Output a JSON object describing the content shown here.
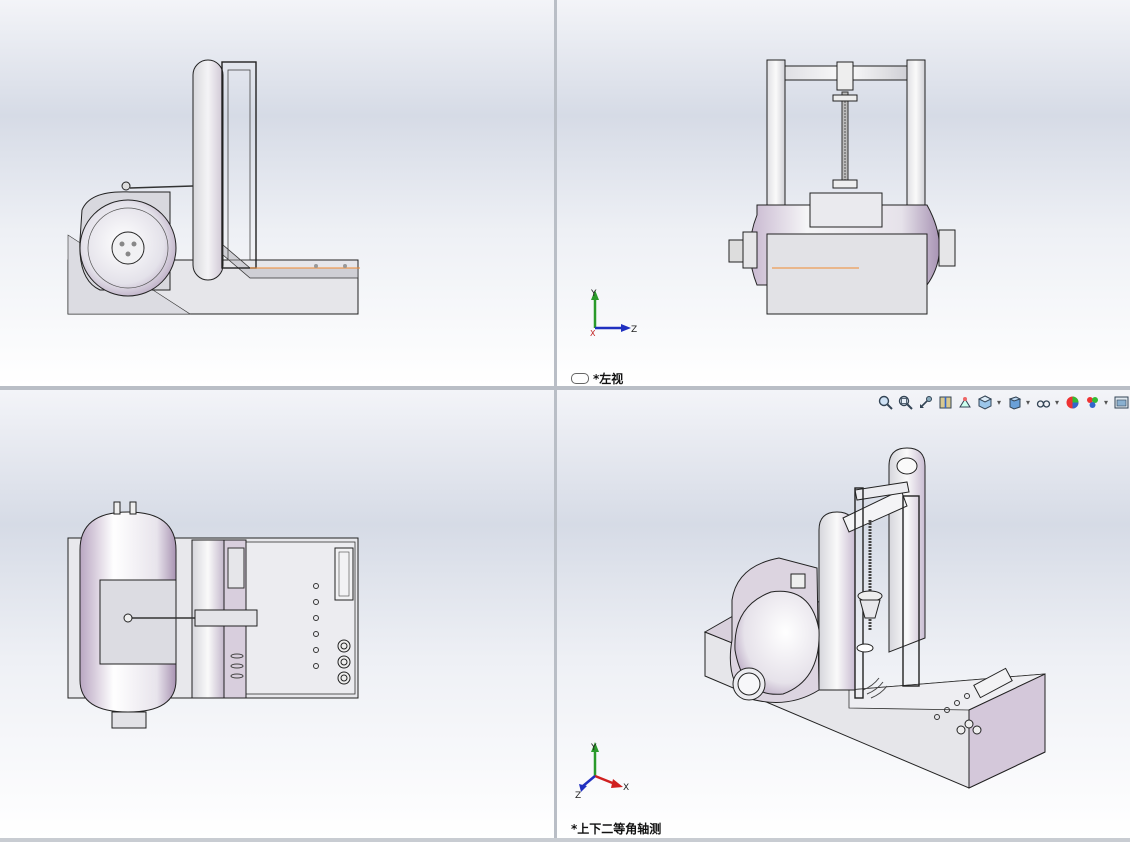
{
  "views": {
    "top_left": {
      "label": ""
    },
    "top_right": {
      "label": "*左视"
    },
    "bottom_left": {
      "label": ""
    },
    "bottom_right": {
      "label": "*上下二等角轴测"
    }
  },
  "triad": {
    "y": "Y",
    "x": "X",
    "z": "Z"
  },
  "toolbar": {
    "icons": [
      "zoom-to-fit-icon",
      "zoom-to-area-icon",
      "previous-view-icon",
      "section-view-icon",
      "dynamic-annotation-icon",
      "view-orientation-icon",
      "display-style-icon",
      "hide-show-items-icon",
      "edit-appearance-icon",
      "apply-scene-icon",
      "view-settings-icon"
    ]
  },
  "colors": {
    "body": "#e8e8ec",
    "outline": "#222222",
    "shade": "#c9b8cf",
    "accent_line": "#f08a30",
    "triad_y": "#2a9a2a",
    "triad_x": "#d02020",
    "triad_z": "#2030c0"
  }
}
